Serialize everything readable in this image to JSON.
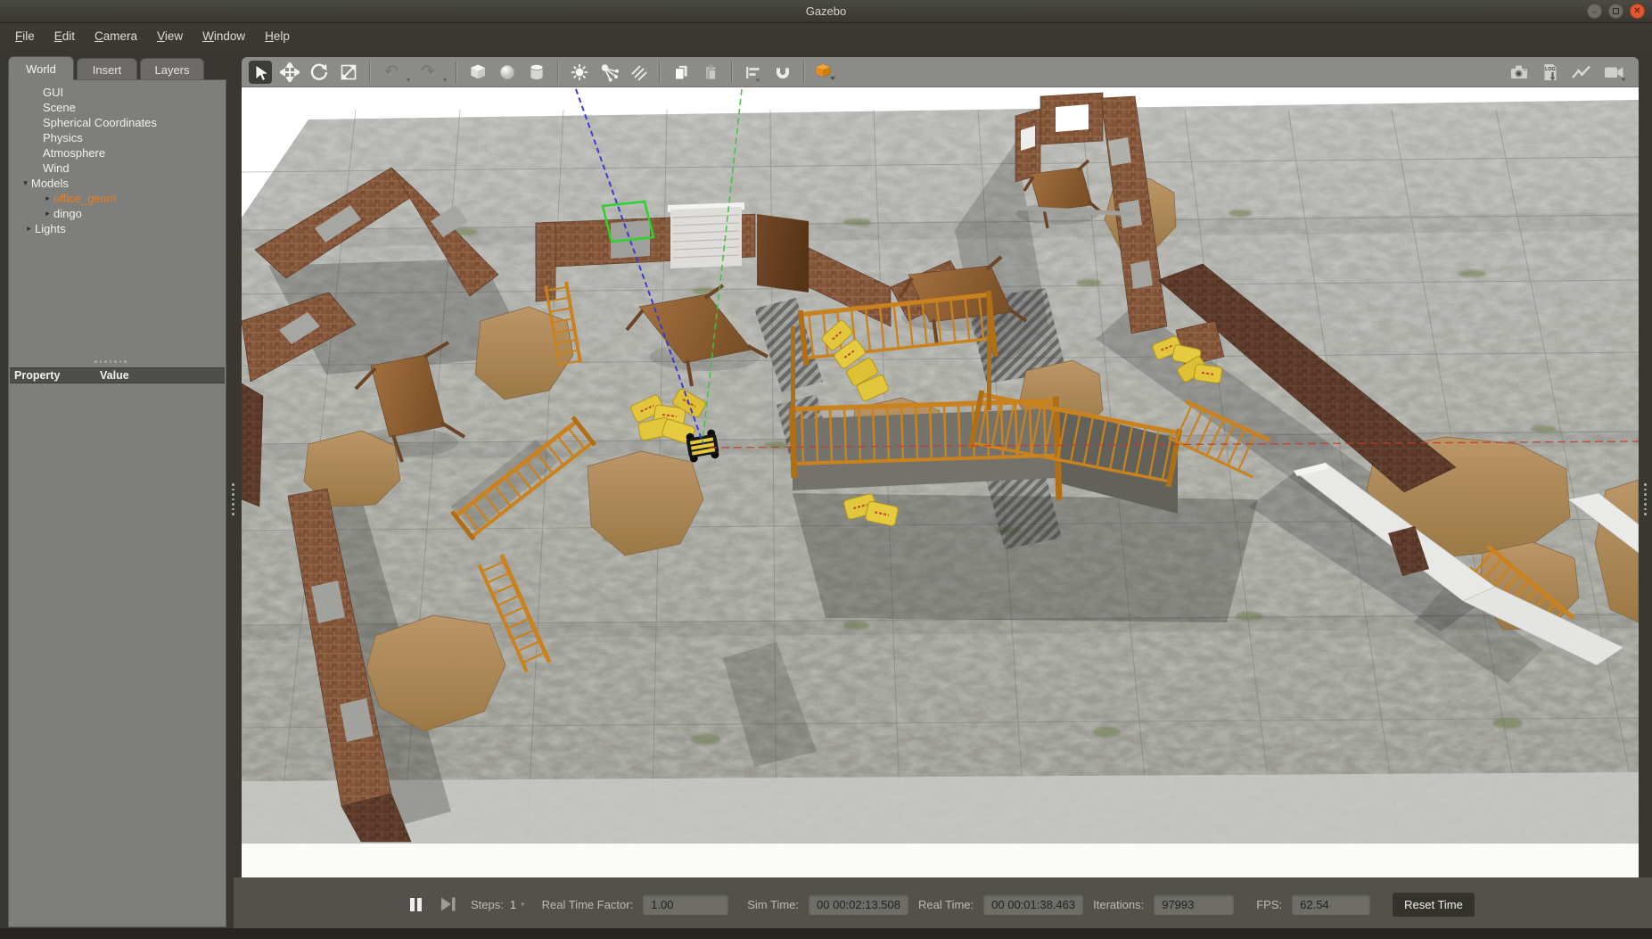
{
  "window": {
    "title": "Gazebo",
    "controls": [
      "minimize",
      "maximize",
      "close"
    ]
  },
  "menu": {
    "items": [
      "File",
      "Edit",
      "Camera",
      "View",
      "Window",
      "Help"
    ]
  },
  "panel": {
    "tabs": [
      "World",
      "Insert",
      "Layers"
    ],
    "active_tab": "World",
    "tree": {
      "gui": "GUI",
      "scene": "Scene",
      "spherical": "Spherical Coordinates",
      "physics": "Physics",
      "atmosphere": "Atmosphere",
      "wind": "Wind",
      "models": "Models",
      "office_geom": "office_geom",
      "dingo": "dingo",
      "lights": "Lights"
    },
    "property_table": {
      "property_col": "Property",
      "value_col": "Value"
    }
  },
  "toolbar": {
    "tools": [
      "select",
      "translate",
      "rotate",
      "scale",
      "undo",
      "redo",
      "box",
      "sphere",
      "cylinder",
      "point-light",
      "spot-light",
      "directional-light",
      "copy",
      "paste",
      "align",
      "snap",
      "view-angle",
      "screenshot",
      "log-record",
      "plot",
      "video-record"
    ],
    "view_cube_color": "#e8881a"
  },
  "statusbar": {
    "steps_label": "Steps:",
    "steps_value": "1",
    "rtf_label": "Real Time Factor:",
    "rtf_value": "1.00",
    "sim_label": "Sim Time:",
    "sim_value": "00 00:02:13.508",
    "real_label": "Real Time:",
    "real_value": "00 00:01:38.463",
    "iter_label": "Iterations:",
    "iter_value": "97993",
    "fps_label": "FPS:",
    "fps_value": "62.54",
    "reset_label": "Reset Time"
  },
  "scene": {
    "selected_model": "office_geom",
    "robot_model": "dingo",
    "objects": [
      "concrete-tile-floor",
      "brick-walls",
      "wooden-tables",
      "orange-railings",
      "dirt-piles",
      "yellow-sacks",
      "dingo-robot",
      "white-wall-panels"
    ],
    "colors": {
      "floor": "#a7a7a2",
      "brick": "#9a6e4e",
      "brick_dark": "#6b4533",
      "wood": "#8a5a33",
      "railing": "#c9821e",
      "dirt": "#b08c5c",
      "sack": "#e2c63b",
      "selection_box": "#2bd42b",
      "axis_blue": "#3a3ad6",
      "axis_green": "#3ec43e",
      "axis_red": "#c83a2e"
    }
  }
}
